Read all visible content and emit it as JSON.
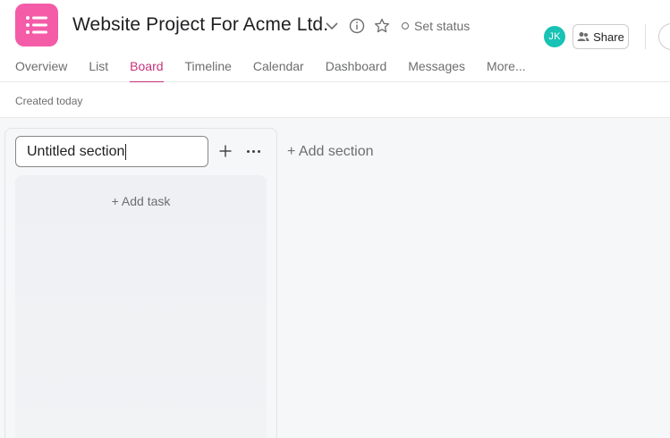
{
  "project": {
    "title": "Website Project For Acme Ltd.",
    "icon": "list-icon",
    "accent_color": "#f45ca8",
    "set_status_label": "Set status"
  },
  "header": {
    "avatar_initials": "JK",
    "avatar_color": "#18c2b4",
    "share_label": "Share"
  },
  "tabs": [
    {
      "label": "Overview",
      "active": false
    },
    {
      "label": "List",
      "active": false
    },
    {
      "label": "Board",
      "active": true
    },
    {
      "label": "Timeline",
      "active": false
    },
    {
      "label": "Calendar",
      "active": false
    },
    {
      "label": "Dashboard",
      "active": false
    },
    {
      "label": "Messages",
      "active": false
    },
    {
      "label": "More...",
      "active": false
    }
  ],
  "subheader": {
    "created_text": "Created today"
  },
  "board": {
    "section": {
      "name_value": "Untitled section",
      "add_task_label": "+ Add task"
    },
    "add_section_label": "+ Add section"
  }
}
